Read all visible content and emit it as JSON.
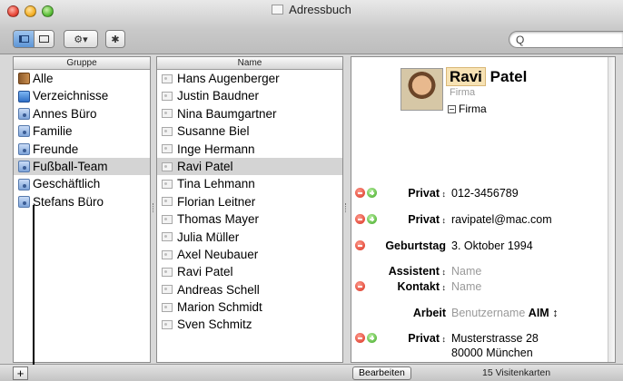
{
  "window": {
    "title": "Adressbuch"
  },
  "toolbar": {
    "search_glyph": "Q",
    "gear_label": "⚙▾",
    "bluetooth_label": "✱"
  },
  "groups": {
    "header": "Gruppe",
    "items": [
      "Alle",
      "Verzeichnisse",
      "Annes Büro",
      "Familie",
      "Freunde",
      "Fußball-Team",
      "Geschäftlich",
      "Stefans Büro"
    ],
    "selected": "Fußball-Team"
  },
  "names": {
    "header": "Name",
    "items": [
      "Hans Augenberger",
      "Justin Baudner",
      "Nina Baumgartner",
      "Susanne Biel",
      "Inge Hermann",
      "Ravi Patel",
      "Tina Lehmann",
      "Florian Leitner",
      "Thomas Mayer",
      "Julia Müller",
      "Axel Neubauer",
      "Ravi Patel",
      "Andreas Schell",
      "Marion Schmidt",
      "Sven Schmitz"
    ],
    "selected_index": 5
  },
  "card": {
    "first_name": "Ravi",
    "last_name": "Patel",
    "company_placeholder": "Firma",
    "company_checkbox": "Firma",
    "phone": {
      "label": "Privat",
      "value": "012-3456789"
    },
    "email": {
      "label": "Privat",
      "value": "ravipatel@mac.com"
    },
    "birthday": {
      "label": "Geburtstag",
      "value": "3. Oktober 1994"
    },
    "assistant": {
      "label": "Assistent",
      "value": "Name"
    },
    "contact": {
      "label": "Kontakt",
      "value": "Name"
    },
    "im": {
      "label": "Arbeit",
      "value": "Benutzername",
      "service": "AIM"
    },
    "address": {
      "label": "Privat",
      "line1": "Musterstrasse 28",
      "line2": "80000 München"
    }
  },
  "bottombar": {
    "add": "+",
    "edit": "Bearbeiten",
    "count": "15 Visitenkarten"
  }
}
